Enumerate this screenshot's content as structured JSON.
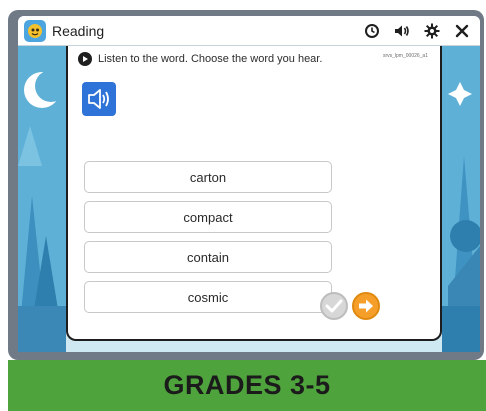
{
  "window": {
    "title": "Reading",
    "icons": [
      "clock-icon",
      "speaker-icon",
      "gear-icon",
      "close-icon"
    ]
  },
  "question": {
    "instruction": "Listen to the word. Choose the word you hear.",
    "item_code": "srvs_lpm_00026_a1",
    "audio_icon": "speaker-icon"
  },
  "answers": [
    "carton",
    "compact",
    "contain",
    "cosmic"
  ],
  "footer": {
    "banner_text": "GRADES 3-5"
  },
  "colors": {
    "accent_blue": "#2e73d8",
    "next_orange": "#f59f2a",
    "banner_green": "#4fa33d",
    "frame_gray": "#6f7a86"
  }
}
